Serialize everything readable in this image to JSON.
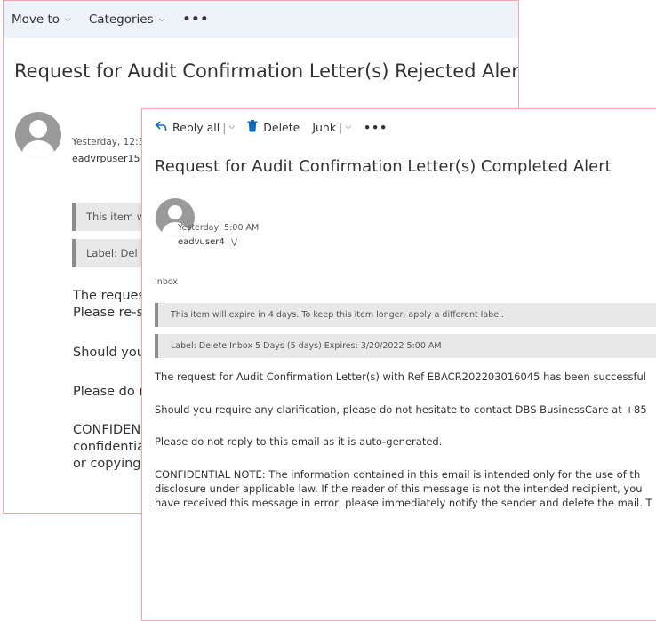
{
  "back_window": {
    "toolbar": {
      "move_to": "Move to",
      "categories": "Categories",
      "more": "•••"
    },
    "subject": "Request for Audit Confirmation Letter(s) Rejected Alert",
    "timestamp": "Yesterday, 12:3",
    "sender": "eadvrpuser15",
    "info_expire": "This item w",
    "info_label": "Label: Del",
    "body": {
      "p1_line1": "The reques",
      "p1_line2": "Please re-su",
      "p2": "Should you",
      "p3": "Please do n",
      "p4_line1": "CONFIDEN",
      "p4_line2": "confidentia",
      "p4_line3": "or copying"
    }
  },
  "front_window": {
    "toolbar": {
      "reply_all": "Reply all",
      "delete": "Delete",
      "junk": "Junk",
      "more": "•••"
    },
    "subject": "Request for Audit Confirmation Letter(s) Completed Alert",
    "timestamp": "Yesterday, 5:00 AM",
    "sender": "eadvuser4",
    "folder": "Inbox",
    "info_expire": "This item will expire in 4 days. To keep this item longer, apply a different label.",
    "info_label": "Label: Delete Inbox 5 Days (5 days) Expires: 3/20/2022 5:00 AM",
    "body": {
      "p1": "The request for Audit Confirmation Letter(s) with Ref EBACR202203016045 has been successful",
      "p2": "Should you require any clarification, please do not hesitate to contact DBS BusinessCare at +85",
      "p3": "Please do not reply to this email as it is auto-generated.",
      "p4_line1": "CONFIDENTIAL NOTE: The information contained in this email is intended only for the use of th",
      "p4_line2": "disclosure under applicable law. If the reader of this message is not the intended recipient, you",
      "p4_line3": "have received this message in error, please immediately notify the sender and delete the mail. T"
    }
  },
  "colors": {
    "window_border": "#f3a7ad",
    "toolbar_bg": "#eef3f9",
    "accent_blue": "#0f6cbd",
    "infobar_bg": "#e8e8e8"
  },
  "icons": {
    "reply_all": "reply-all-icon",
    "delete": "trash-icon",
    "avatar": "person-avatar",
    "expand": "double-chevron-down-icon"
  }
}
